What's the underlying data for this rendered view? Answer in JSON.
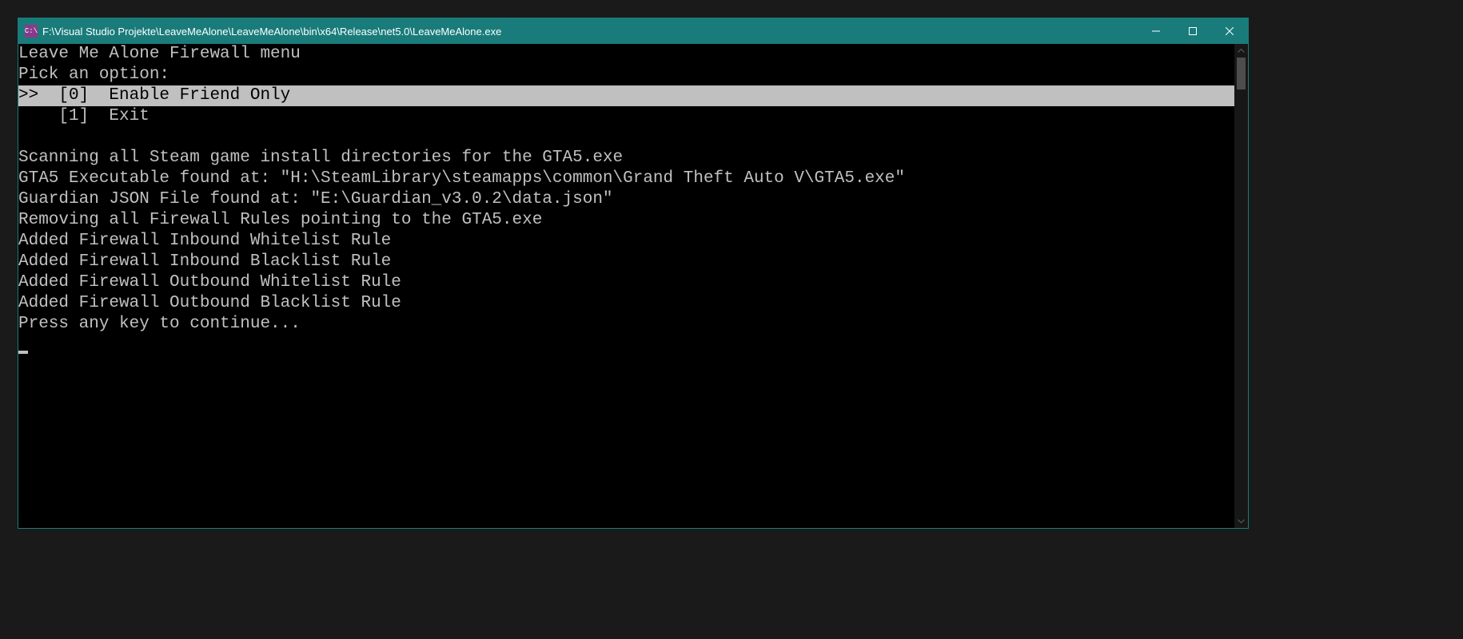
{
  "titlebar": {
    "icon_text": "C:\\",
    "title": "F:\\Visual Studio Projekte\\LeaveMeAlone\\LeaveMeAlone\\bin\\x64\\Release\\net5.0\\LeaveMeAlone.exe"
  },
  "console": {
    "lines": [
      {
        "text": "Leave Me Alone Firewall menu",
        "highlighted": false
      },
      {
        "text": "Pick an option:",
        "highlighted": false
      },
      {
        "text": ">>  [0]  Enable Friend Only",
        "highlighted": true
      },
      {
        "text": "    [1]  Exit",
        "highlighted": false
      },
      {
        "text": "",
        "highlighted": false
      },
      {
        "text": "Scanning all Steam game install directories for the GTA5.exe",
        "highlighted": false
      },
      {
        "text": "GTA5 Executable found at: \"H:\\SteamLibrary\\steamapps\\common\\Grand Theft Auto V\\GTA5.exe\"",
        "highlighted": false
      },
      {
        "text": "Guardian JSON File found at: \"E:\\Guardian_v3.0.2\\data.json\"",
        "highlighted": false
      },
      {
        "text": "Removing all Firewall Rules pointing to the GTA5.exe",
        "highlighted": false
      },
      {
        "text": "Added Firewall Inbound Whitelist Rule",
        "highlighted": false
      },
      {
        "text": "Added Firewall Inbound Blacklist Rule",
        "highlighted": false
      },
      {
        "text": "Added Firewall Outbound Whitelist Rule",
        "highlighted": false
      },
      {
        "text": "Added Firewall Outbound Blacklist Rule",
        "highlighted": false
      },
      {
        "text": "Press any key to continue...",
        "highlighted": false
      }
    ]
  }
}
